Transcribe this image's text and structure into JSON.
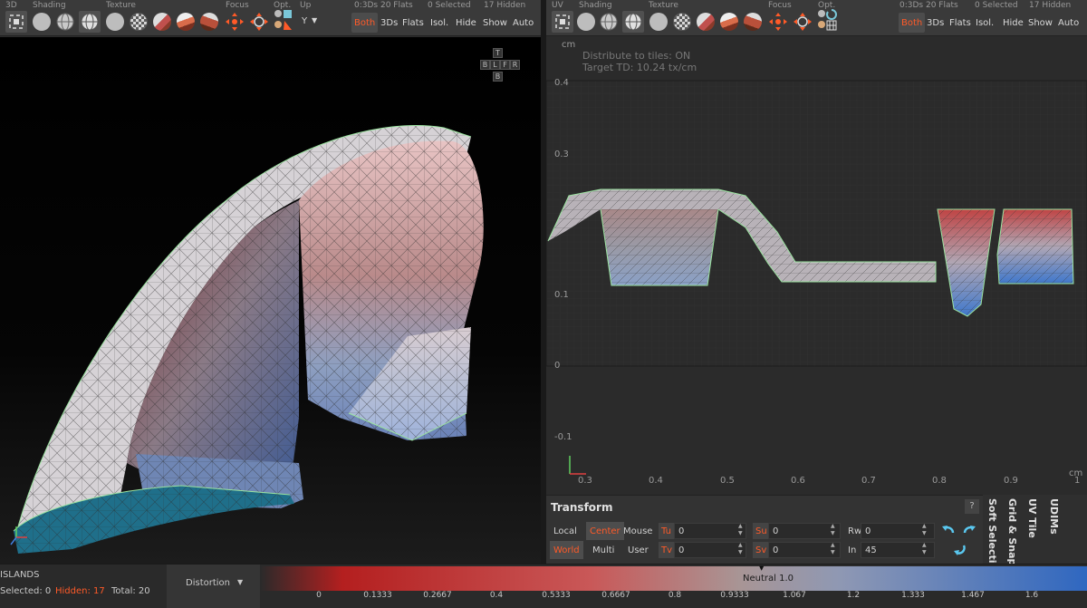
{
  "left_toolbar": {
    "labels": {
      "mode": "3D",
      "shading": "Shading",
      "texture": "Texture",
      "focus": "Focus",
      "opt": "Opt.",
      "up": "Up"
    },
    "counts": "0:3Ds 20 Flats",
    "selected": "0 Selected",
    "hidden": "17 Hidden",
    "up_axis": "Y",
    "filters": {
      "both": "Both",
      "threeds": "3Ds",
      "flats": "Flats",
      "isol": "Isol.",
      "hide": "Hide",
      "show": "Show",
      "auto": "Auto"
    }
  },
  "right_toolbar": {
    "labels": {
      "mode": "UV",
      "shading": "Shading",
      "texture": "Texture",
      "focus": "Focus",
      "opt": "Opt."
    },
    "counts": "0:3Ds 20 Flats",
    "selected": "0 Selected",
    "hidden": "17 Hidden",
    "filters": {
      "both": "Both",
      "threeds": "3Ds",
      "flats": "Flats",
      "isol": "Isol.",
      "hide": "Hide",
      "show": "Show",
      "auto": "Auto"
    }
  },
  "view_cube": {
    "top": "T",
    "bottom": "B",
    "back": "B",
    "left": "L",
    "front": "F",
    "right": "R"
  },
  "uv_view": {
    "info_line1": "Distribute to tiles: ON",
    "info_line2": "Target TD: 10.24 tx/cm",
    "unit_top": "cm",
    "unit_bottom": "cm",
    "y_ticks": [
      "0.4",
      "0.3",
      "0.1",
      "0",
      "-0.1"
    ],
    "x_ticks": [
      "0.3",
      "0.4",
      "0.5",
      "0.6",
      "0.7",
      "0.8",
      "0.9",
      "1"
    ]
  },
  "transform": {
    "title": "Transform",
    "help": "?",
    "local": "Local",
    "world": "World",
    "center": "Center",
    "multi": "Multi",
    "mouse": "Mouse",
    "user": "User",
    "tu_label": "Tu",
    "tu_value": "0",
    "tv_label": "Tv",
    "tv_value": "0",
    "su_label": "Su",
    "su_value": "0",
    "sv_label": "Sv",
    "sv_value": "0",
    "rw_label": "Rw",
    "rw_value": "0",
    "in_label": "In",
    "in_value": "45"
  },
  "side_tabs": [
    "Soft Selectio",
    "Grid & Snap",
    "UV Tile",
    "UDIMs"
  ],
  "status": {
    "islands": "ISLANDS",
    "selected": "Selected: 0",
    "hidden": "Hidden: 17",
    "total": "Total: 20",
    "mode": "Distortion",
    "neutral": "Neutral 1.0",
    "scale": [
      "0",
      "0.1333",
      "0.2667",
      "0.4",
      "0.5333",
      "0.6667",
      "0.8",
      "0.9333",
      "1.067",
      "1.2",
      "1.333",
      "1.467",
      "1.6"
    ]
  },
  "colors": {
    "accent": "#ff5a28",
    "selection_edge": "#9be3a0",
    "stretch_red": "#b41f1f",
    "compress_blue": "#2f67c0"
  }
}
